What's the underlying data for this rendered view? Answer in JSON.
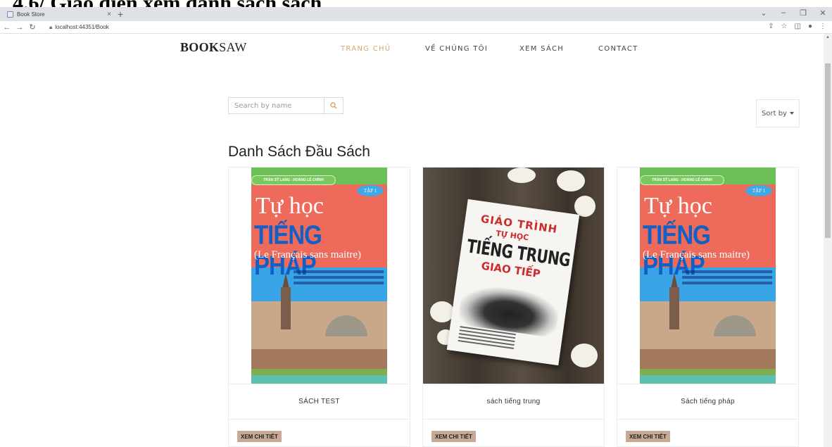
{
  "document": {
    "heading": "4.6/ Giao diện xem danh sách sách"
  },
  "browser": {
    "tab_title": "Book Store",
    "tab_close": "×",
    "new_tab": "+",
    "url": "localhost:44351/Book",
    "window_controls": [
      "⌄",
      "–",
      "❐",
      "✕"
    ]
  },
  "site": {
    "logo_bold": "BOOK",
    "logo_light": "SAW",
    "nav": [
      {
        "label": "TRANG CHỦ",
        "active": true
      },
      {
        "label": "VỀ CHÚNG TÔI",
        "active": false
      },
      {
        "label": "XEM SÁCH",
        "active": false
      },
      {
        "label": "CONTACT",
        "active": false
      }
    ],
    "accent_color": "#d6a56f"
  },
  "search": {
    "placeholder": "Search by name"
  },
  "sort": {
    "label": "Sort by"
  },
  "section_title": "Danh Sách Đầu Sách",
  "books": [
    {
      "title": "SÁCH TEST",
      "button": "XEM CHI TIẾT",
      "cover": "french"
    },
    {
      "title": "sách tiếng trung",
      "button": "XEM CHI TIẾT",
      "cover": "chinese"
    },
    {
      "title": "Sách tiếng pháp",
      "button": "XEM CHI TIẾT",
      "cover": "french"
    }
  ],
  "covers": {
    "french": {
      "author": "TRẦN SỸ LANG - HOÀNG LÊ CHÍNH",
      "volume": "TẬP 1",
      "line1": "Tự học",
      "line2": "TIẾNG PHÁP",
      "line3": "(Le Français sans maitre)"
    },
    "chinese": {
      "line1": "GIÁO TRÌNH",
      "line2": "TỰ HỌC",
      "line3": "TIẾNG TRUNG",
      "line4": "GIAO TIẾP"
    }
  }
}
